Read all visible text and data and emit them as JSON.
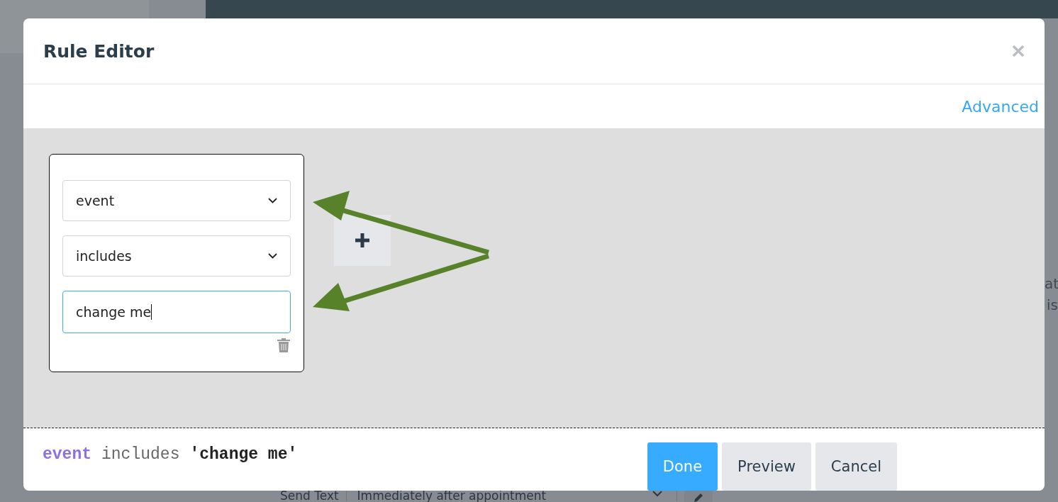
{
  "background": {
    "side_text": [
      "at",
      "is"
    ],
    "row": {
      "action": "Send Text",
      "timing": "Immediately after appointment"
    }
  },
  "modal": {
    "title": "Rule Editor",
    "advanced_link": "Advanced",
    "rule": {
      "field": "event",
      "operator": "includes",
      "value": "change me"
    },
    "query": [
      {
        "kind": "field",
        "text": "event"
      },
      {
        "kind": "operator",
        "text": "includes"
      },
      {
        "kind": "value",
        "text": "'change me'"
      }
    ],
    "buttons": [
      {
        "label": "Done",
        "kind": "primary"
      },
      {
        "label": "Preview",
        "kind": "secondary"
      },
      {
        "label": "Cancel",
        "kind": "secondary"
      }
    ]
  }
}
